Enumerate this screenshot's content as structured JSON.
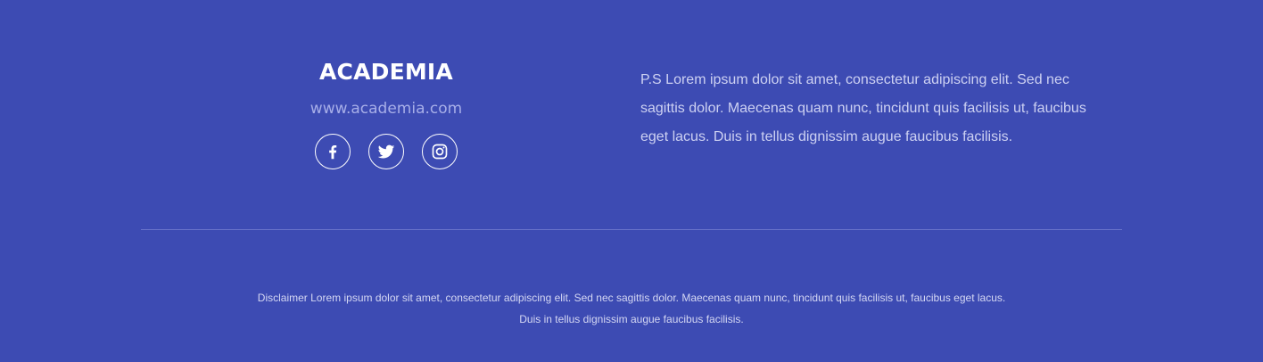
{
  "colors": {
    "background": "#3d4bb3",
    "title": "#ffffff",
    "url": "#a7aee8",
    "body_text": "#cdd1f2",
    "divider": "#6872c9"
  },
  "brand": {
    "title": "ACADEMIA",
    "url": "www.academia.com"
  },
  "socials": [
    {
      "name": "facebook",
      "icon": "facebook-icon"
    },
    {
      "name": "twitter",
      "icon": "twitter-icon"
    },
    {
      "name": "instagram",
      "icon": "instagram-icon"
    }
  ],
  "note": {
    "text": "P.S Lorem ipsum dolor sit amet, consectetur adipiscing elit. Sed nec sagittis dolor. Maecenas quam nunc, tincidunt quis facilisis ut, faucibus eget lacus. Duis in tellus dignissim augue faucibus facilisis."
  },
  "disclaimer": {
    "line1": "Disclaimer Lorem ipsum dolor sit amet, consectetur adipiscing elit. Sed nec sagittis dolor. Maecenas quam nunc, tincidunt quis facilisis ut, faucibus eget lacus.",
    "line2": "Duis in tellus dignissim augue faucibus facilisis."
  }
}
